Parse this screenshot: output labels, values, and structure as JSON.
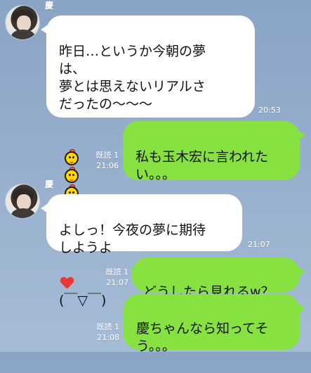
{
  "chat": {
    "messages": [
      {
        "sender": "慶",
        "text": "昨日…というか今朝の夢\nは、\n夢とは思えないリアルさ\nだったの〜〜〜",
        "time": "20:53",
        "emoji": [
          "sticker-face-icon",
          "sticker-face-icon",
          "sticker-face-icon"
        ]
      },
      {
        "read": "既読 1",
        "text": "私も玉木宏に言われた\nい。。。",
        "time": "21:06"
      },
      {
        "sender": "慶",
        "text_before_heart": "よしっ！今夜の夢に期待\nしようよ",
        "text_after_heart": "(￣▽￣)",
        "time": "21:07",
        "emoji": [
          "heart-icon"
        ]
      },
      {
        "read": "既読 1",
        "text": "どうしたら見れるw？",
        "time": "21:07"
      },
      {
        "read": "既読 1",
        "text": "慶ちゃんなら知ってそ\nう。。。",
        "time": "21:08"
      }
    ]
  },
  "colors": {
    "background": "#96aecd",
    "incoming_bubble": "#ffffff",
    "outgoing_bubble": "#86e141",
    "meta_text": "#ffffff"
  }
}
